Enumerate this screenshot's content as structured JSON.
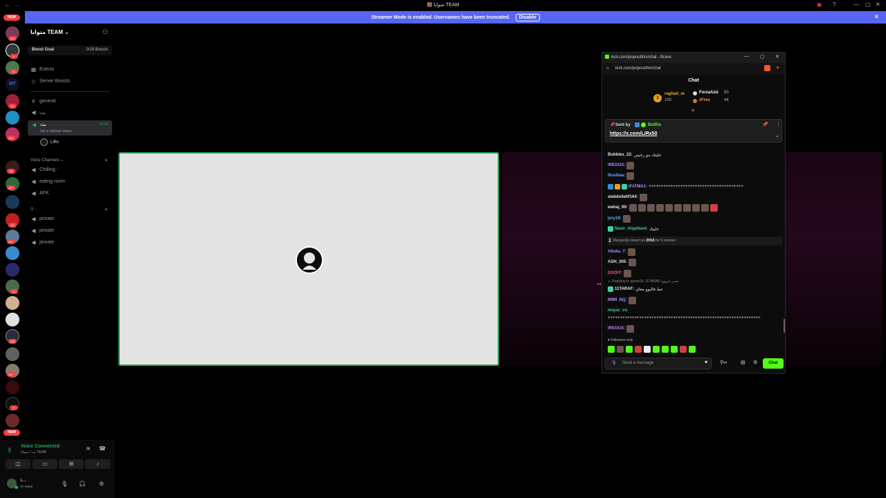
{
  "window": {
    "title": "متوايا TEAM",
    "controls": [
      "—",
      "▢",
      "✕"
    ]
  },
  "banner": {
    "text": "Streamer Mode is enabled. Usernames have been truncated.",
    "button": "Disable"
  },
  "rail": {
    "new_top": "NEW",
    "new_bottom": "NEW",
    "badges": [
      "116",
      "4",
      "61",
      "19",
      "624",
      "26",
      "3K+",
      "25",
      "3K+",
      "74",
      "183",
      "3K+",
      "9"
    ],
    "mt": "MT"
  },
  "sidebar": {
    "guild_name": "متوايا TEAM",
    "boost_goal_label": "Boost Goal",
    "boost_goal_value": "0/28 Boosts",
    "events": "Events",
    "server_boosts": "Server Boosts",
    "channels": [
      {
        "name": "general",
        "icon": "#"
      },
      {
        "name": "بث",
        "icon": "🔊"
      }
    ],
    "active_voice": {
      "name": "بث",
      "status_hint": "Set a channel status",
      "timer": "25:56"
    },
    "voice_member": "LiRx",
    "voice_category": "Voice Channels",
    "voice_channels": [
      "Chilling -",
      "eating room",
      "AFK"
    ],
    "dash_category": "-",
    "private_channels": [
      "private",
      "private",
      "private"
    ]
  },
  "voice_panel": {
    "status": "Voice Connected",
    "location": "بث / متوايا TEAM",
    "user_name": "L...",
    "user_status": "In voice"
  },
  "popout": {
    "window_title": "kick.com/popout/lirx/chat - Brave",
    "url": "kick.com/popout/lirx/chat",
    "chat_header": "Chat",
    "leaderboard": [
      {
        "rank": "1",
        "name": "raghad_re",
        "points": "100"
      },
      {
        "name": "ForzaAziz",
        "points": "50"
      },
      {
        "name": "zFrex",
        "points": "44"
      }
    ],
    "pinned": {
      "sent_by_label": "Sent by",
      "sender": "BotRix",
      "link": "https://x.com/LiRx50"
    },
    "messages": [
      {
        "user": "Bubbles_22:",
        "text": "خليتك مو رخيص",
        "color": "#ffffff"
      },
      {
        "user": "iREOOS:",
        "text": "",
        "color": "#b48cff"
      },
      {
        "user": "Nusibaa:",
        "text": "",
        "color": "#6aa6ff"
      },
      {
        "user": "iFATMA1:",
        "text": "+++++++++++++++++++++++++++++++++++++++",
        "color": "#b48cff"
      },
      {
        "user": "alabdullatif164:",
        "text": "",
        "color": "#ffffff"
      },
      {
        "user": "wahaj_99:",
        "text": "",
        "color": "#ffffff"
      },
      {
        "user": "jory18:",
        "text": "",
        "color": "#6aa6ff"
      },
      {
        "user": "Nasir_Alqahtani:",
        "text": "خليتك",
        "color": "#3fd0a0"
      },
      {
        "user": "Alluka_7:",
        "text": "",
        "color": "#b48cff"
      },
      {
        "user": "ASH_305:",
        "text": "",
        "color": "#ffffff"
      },
      {
        "user": "DOOIY:",
        "text": "",
        "color": "#ff5a7a"
      },
      {
        "user": "11TARAF:",
        "text": "حط فاليوو معاي",
        "color": "#ffffff"
      },
      {
        "user": "MIMI_NQ:",
        "text": "",
        "color": "#b48cff"
      },
      {
        "user": "mayar_vs:",
        "text": "",
        "color": "#3fd0a0"
      },
      {
        "user": "",
        "text": "+++++++++++++++++++++++++++++++++++++++++++++++++++++++++++++++",
        "color": "#ffffff"
      },
      {
        "user": "iREOOS:",
        "text": "",
        "color": "#b48cff"
      }
    ],
    "timeout_notice": {
      "user": "MaryamQs",
      "mid": "timed out",
      "target": "ZH15",
      "tail": "for 5 minutes"
    },
    "reply_hint": "Replying to ajwan10: 11TARAF/ تحس فرووو",
    "followers_only": "Followers only",
    "input_placeholder": "Send a message",
    "send_button": "Chat",
    "colors": {
      "kick_green": "#53fc18"
    }
  }
}
